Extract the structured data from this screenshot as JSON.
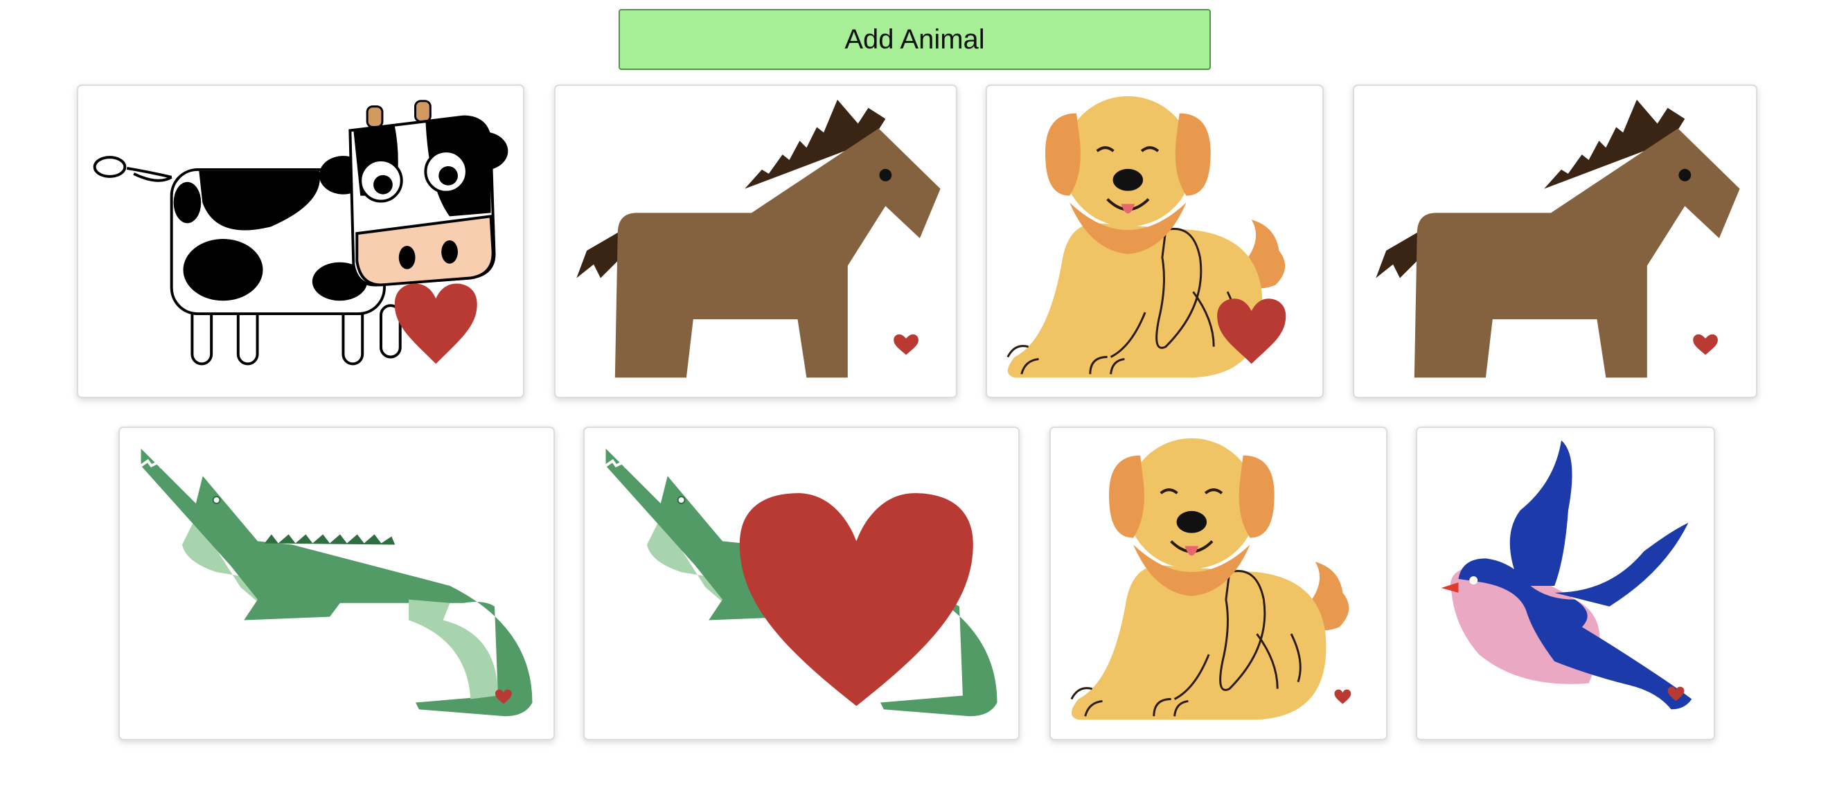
{
  "toolbar": {
    "add_label": "Add Animal"
  },
  "colors": {
    "button_bg": "#a7ef97",
    "heart": "#b83a32",
    "horse": "#84623f",
    "crocodile": "#529a66",
    "dog": "#f0c464",
    "bird": "#1c3aa9"
  },
  "cards": [
    {
      "animal": "cow",
      "heart": "large"
    },
    {
      "animal": "horse",
      "heart": "small"
    },
    {
      "animal": "dog",
      "heart": "large"
    },
    {
      "animal": "horse",
      "heart": "small"
    },
    {
      "animal": "crocodile",
      "heart": "small"
    },
    {
      "animal": "crocodile",
      "heart": "huge"
    },
    {
      "animal": "dog",
      "heart": "small"
    },
    {
      "animal": "bird",
      "heart": "small"
    }
  ]
}
